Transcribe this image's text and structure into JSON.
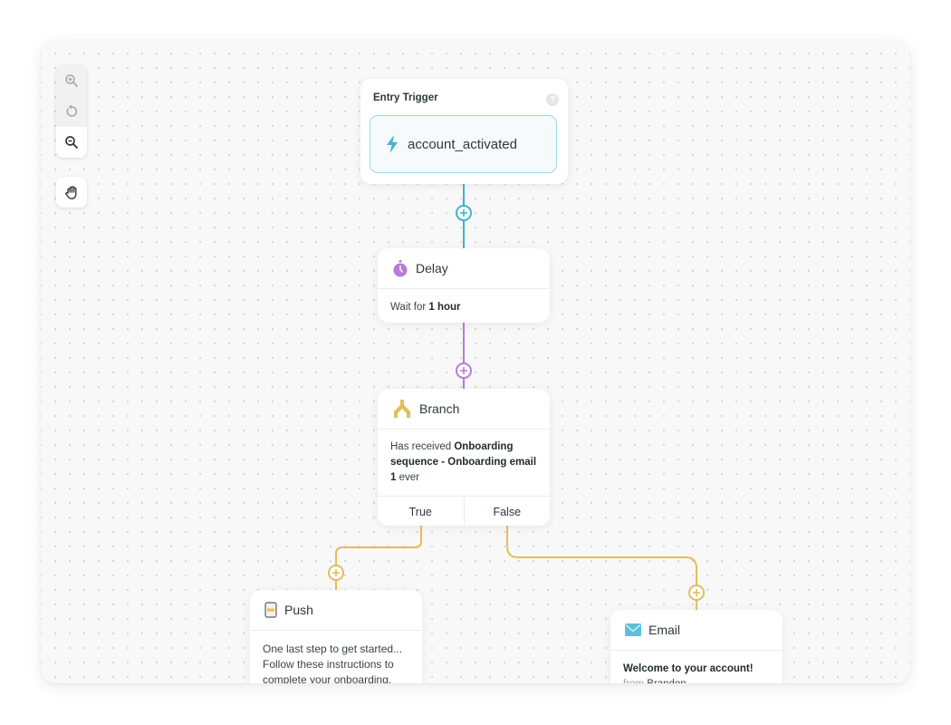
{
  "toolbar": {
    "zoom_in": {
      "icon": "zoom-in-icon",
      "enabled": false
    },
    "reset": {
      "icon": "reset-icon",
      "enabled": false
    },
    "zoom_out": {
      "icon": "zoom-out-icon",
      "enabled": true
    },
    "pan": {
      "icon": "hand-icon"
    }
  },
  "entry": {
    "title": "Entry Trigger",
    "help": "?",
    "trigger_icon": "lightning-icon",
    "trigger_event": "account_activated"
  },
  "delay": {
    "title": "Delay",
    "icon": "stopwatch-icon",
    "body_prefix": "Wait for ",
    "body_value": "1 hour"
  },
  "branch": {
    "title": "Branch",
    "icon": "branch-icon",
    "body_prefix": "Has received ",
    "body_value": "Onboarding sequence - Onboarding email 1",
    "body_suffix": " ever",
    "options": [
      "True",
      "False"
    ]
  },
  "push": {
    "title": "Push",
    "icon": "phone-icon",
    "body": "One last step to get started... Follow these instructions to complete your onboarding."
  },
  "email": {
    "title": "Email",
    "icon": "envelope-icon",
    "subject": "Welcome to your account!",
    "from_label": "from",
    "from_value": "Brandon"
  },
  "colors": {
    "trigger": "#3bb5cf",
    "delay": "#b77bd9",
    "branch": "#e3bd5c"
  }
}
